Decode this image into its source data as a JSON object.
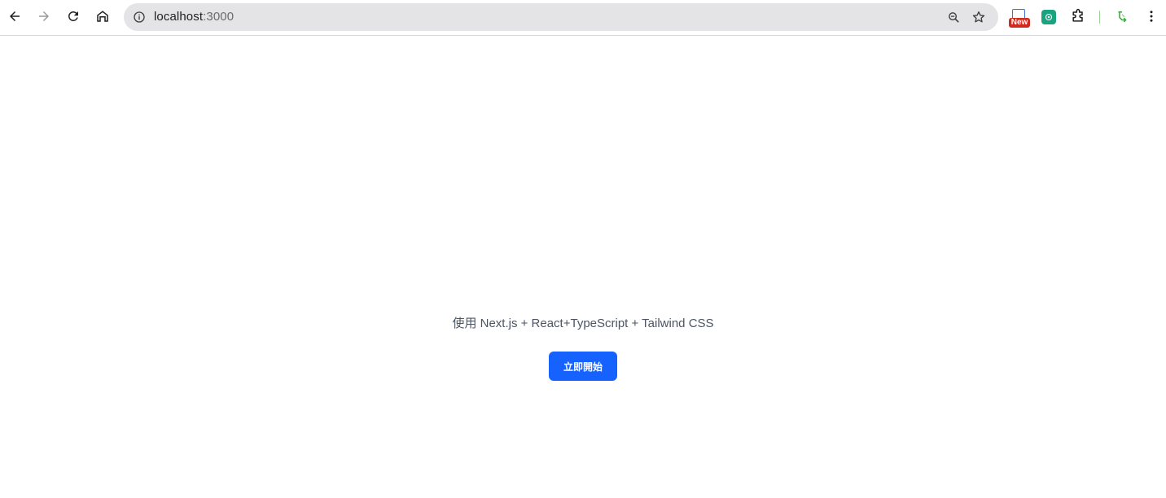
{
  "browser": {
    "url_host": "localhost",
    "url_port": ":3000",
    "ext_new_badge": "New"
  },
  "page": {
    "tagline": "使用 Next.js + React+TypeScript + Tailwind CSS",
    "cta_label": "立即開始"
  },
  "colors": {
    "accent": "#1662ff",
    "tagline_text": "#4b5563"
  }
}
